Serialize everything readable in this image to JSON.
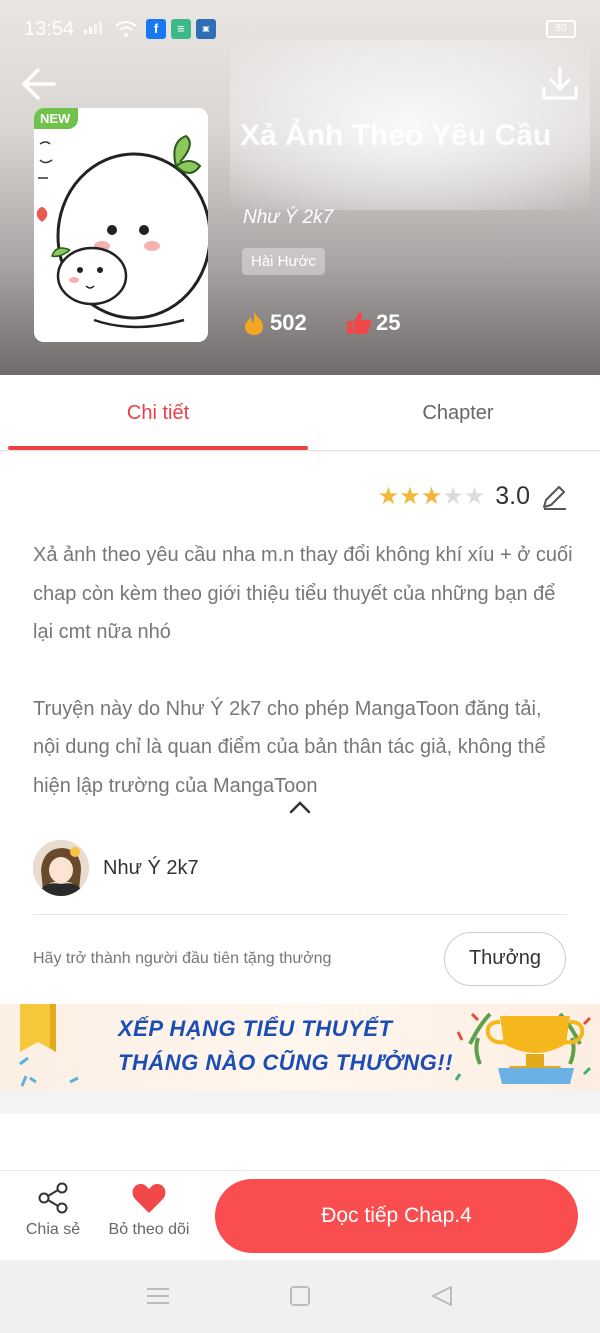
{
  "status_bar": {
    "time": "13:54",
    "battery": "80"
  },
  "header": {
    "new_badge": "NEW",
    "title": "Xả Ảnh Theo Yêu Cầu",
    "author": "Như Ý 2k7",
    "genre": "Hài Hước",
    "views": "502",
    "likes": "25"
  },
  "tabs": [
    {
      "label": "Chi tiết",
      "active": true
    },
    {
      "label": "Chapter",
      "active": false
    }
  ],
  "rating": {
    "value": "3.0",
    "stars_filled": 3,
    "stars_total": 5
  },
  "description": {
    "paragraph1": "Xả ảnh theo yêu cầu nha m.n thay đổi không khí xíu + ở cuối chap còn kèm theo giới thiệu tiểu thuyết của những bạn để lại cmt nữa nhó",
    "paragraph2": "Truyện này do Như Ý 2k7 cho phép MangaToon đăng tải, nội dung chỉ là quan điểm của bản thân tác giả, không thể hiện lập trường của MangaToon"
  },
  "author_row": {
    "name": "Như Ý 2k7"
  },
  "reward": {
    "text": "Hãy trở thành người đầu tiên tặng thưởng",
    "button": "Thưởng"
  },
  "banner": {
    "line1": "XẾP HẠNG TIỂU THUYẾT",
    "line2": "THÁNG NÀO CŨNG THƯỞNG!!"
  },
  "bottom_bar": {
    "share_label": "Chia sẻ",
    "unfollow_label": "Bỏ theo dõi",
    "read_button": "Đọc tiếp Chap.4"
  },
  "colors": {
    "accent": "#ee3f45",
    "read_button": "#f94d4f",
    "star_filled": "#f5b73b",
    "star_empty": "#dcdcdc",
    "banner_text": "#1a4eb5"
  }
}
